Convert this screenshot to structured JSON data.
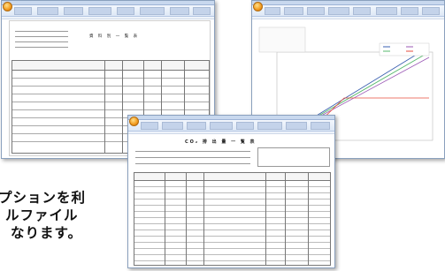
{
  "windows": {
    "table_sheet": {
      "doc_title": "資 料 別 一 覧 表"
    },
    "chart_sheet": {
      "chart_data": {
        "type": "line",
        "title": "",
        "xlabel": "",
        "ylabel": "",
        "series": [
          {
            "name": "",
            "color": "#3a5fb0"
          },
          {
            "name": "",
            "color": "#55b86c"
          },
          {
            "name": "",
            "color": "#9b59b6"
          },
          {
            "name": "",
            "color": "#e74c3c"
          }
        ]
      }
    },
    "report_sheet": {
      "doc_title": "CO₂ 排 出 量 一 覧 表"
    }
  },
  "caption": {
    "line1": "プションを利",
    "line2": "ルファイル",
    "line3": "なります。"
  },
  "colors": {
    "ribbon": "#dde8f6",
    "office_orb": "#f29a1c"
  }
}
